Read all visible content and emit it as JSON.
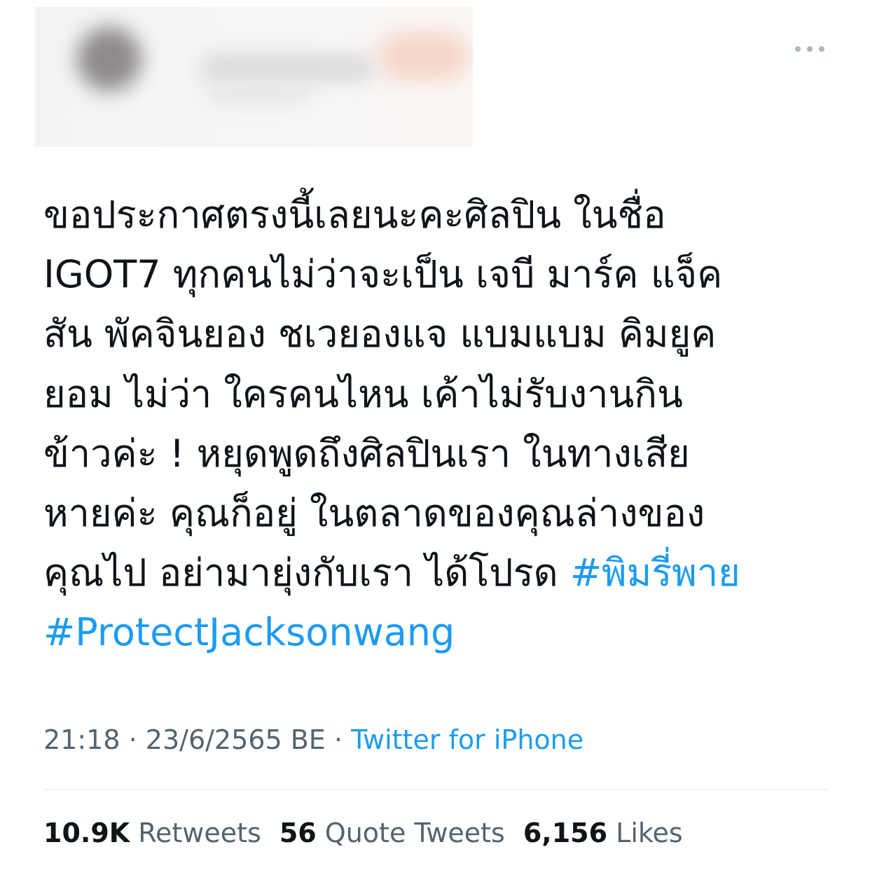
{
  "tweet": {
    "body_lines": [
      "ขอประกาศตรงนี้เลยนะคะศิลปิน ในชื่อ",
      "IGOT7 ทุกคนไม่ว่าจะเป็น เจบี มาร์ค แจ็ค",
      "สัน พัคจินยอง ชเวยองแจ แบมแบม คิมยูค",
      "ยอม ไม่ว่า ใครคนไหน เค้าไม่รับงานกิน",
      "ข้าวค่ะ ! หยุดพูดถึงศิลปินเรา ในทางเสีย",
      "หายค่ะ คุณก็อยู่ ในตลาดของคุณล่างของ",
      "คุณไป อย่ามายุ่งกับเรา ได้โปรด "
    ],
    "hashtags": [
      "#พิมรี่พาย",
      "#ProtectJacksonwang"
    ],
    "time": "21:18",
    "date": "23/6/2565 BE",
    "source": "Twitter for iPhone",
    "separator": "·"
  },
  "stats": {
    "retweets": {
      "count": "10.9K",
      "label": "Retweets"
    },
    "quote_tweets": {
      "count": "56",
      "label": "Quote Tweets"
    },
    "likes": {
      "count": "6,156",
      "label": "Likes"
    }
  },
  "colors": {
    "link": "#1d9bf0",
    "muted": "#536471",
    "text": "#0f1419",
    "divider": "#eff3f4"
  },
  "icons": {
    "more": "more-horizontal-icon"
  }
}
